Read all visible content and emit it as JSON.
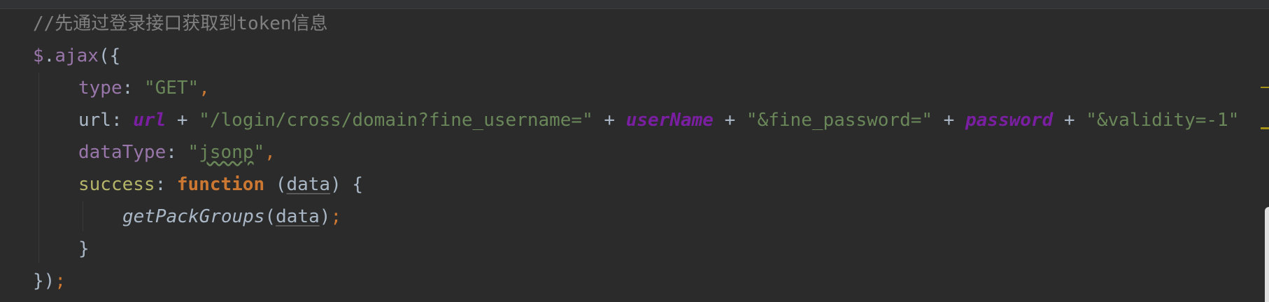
{
  "code": {
    "line1": {
      "comment": "//先通过登录接口获取到token信息"
    },
    "line2": {
      "dollar": "$",
      "dot": ".",
      "method": "ajax",
      "open": "({"
    },
    "line3": {
      "key": "type",
      "colon": ": ",
      "value": "\"GET\"",
      "comma": ","
    },
    "line4": {
      "key": "url",
      "colon": ": ",
      "var1": "url",
      "plus1": " + ",
      "str1": "\"/login/cross/domain?fine_username=\"",
      "plus2": " + ",
      "var2": "userName",
      "plus3": " + ",
      "str2": "\"&fine_password=\"",
      "plus4": " + ",
      "var3": "password",
      "plus5": " + ",
      "str3": "\"&validity=-1\""
    },
    "line5": {
      "key": "dataType",
      "colon": ": ",
      "q1": "\"",
      "value": "jsonp",
      "q2": "\"",
      "comma": ","
    },
    "line6": {
      "key": "success",
      "colon": ": ",
      "keyword": "function",
      "space": " ",
      "open": "(",
      "param": "data",
      "close": ") {"
    },
    "line7": {
      "fn": "getPackGroups",
      "open": "(",
      "arg": "data",
      "close": ")",
      "semi": ";"
    },
    "line8": {
      "brace": "}"
    },
    "line9": {
      "close": "})",
      "semi": ";"
    }
  },
  "colors": {
    "background": "#2b2b2b",
    "comment": "#808080",
    "string": "#6a8759",
    "keyword": "#cc7832",
    "property": "#9876aa"
  }
}
